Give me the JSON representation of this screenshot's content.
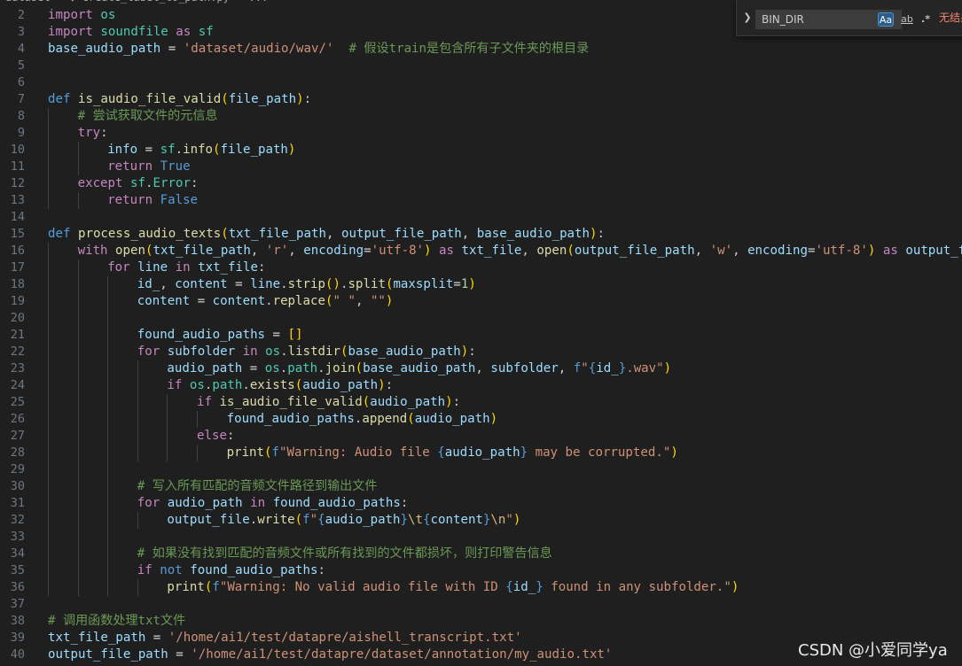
{
  "breadcrumb": "dataset > ◆ create_label_to_path.py > ...",
  "find": {
    "query": "BIN_DIR",
    "match_case": "Aa",
    "whole_word": "ab",
    "regex": ".*",
    "no_results": "无结果"
  },
  "watermark": "CSDN @小爱同学ya",
  "code_lines": [
    {
      "n": "2",
      "indent": 0,
      "tokens": [
        [
          "import",
          "ctl"
        ],
        [
          " "
        ],
        [
          "os",
          "mod"
        ]
      ]
    },
    {
      "n": "3",
      "indent": 0,
      "tokens": [
        [
          "import",
          "ctl"
        ],
        [
          " "
        ],
        [
          "soundfile",
          "mod"
        ],
        [
          " "
        ],
        [
          "as",
          "ctl"
        ],
        [
          " "
        ],
        [
          "sf",
          "mod"
        ]
      ]
    },
    {
      "n": "4",
      "indent": 0,
      "tokens": [
        [
          "base_audio_path",
          "var"
        ],
        [
          " = ",
          "op"
        ],
        [
          "'dataset/audio/wav/'",
          "str"
        ],
        [
          "  "
        ],
        [
          "# 假设train是包含所有子文件夹的根目录",
          "cmt"
        ]
      ]
    },
    {
      "n": "5",
      "indent": 0,
      "tokens": []
    },
    {
      "n": "6",
      "indent": 0,
      "tokens": []
    },
    {
      "n": "7",
      "indent": 0,
      "tokens": [
        [
          "def",
          "kw"
        ],
        [
          " "
        ],
        [
          "is_audio_file_valid",
          "fn"
        ],
        [
          "(",
          "p1"
        ],
        [
          "file_path",
          "var"
        ],
        [
          ")",
          "p1"
        ],
        [
          ":"
        ]
      ]
    },
    {
      "n": "8",
      "indent": 1,
      "tokens": [
        [
          "# 尝试获取文件的元信息",
          "cmt"
        ]
      ]
    },
    {
      "n": "9",
      "indent": 1,
      "tokens": [
        [
          "try",
          "ctl"
        ],
        [
          ":"
        ]
      ]
    },
    {
      "n": "10",
      "indent": 2,
      "tokens": [
        [
          "info",
          "var"
        ],
        [
          " = ",
          "op"
        ],
        [
          "sf",
          "mod"
        ],
        [
          "."
        ],
        [
          "info",
          "fn"
        ],
        [
          "(",
          "p1"
        ],
        [
          "file_path",
          "var"
        ],
        [
          ")",
          "p1"
        ]
      ]
    },
    {
      "n": "11",
      "indent": 2,
      "tokens": [
        [
          "return",
          "ctl"
        ],
        [
          " "
        ],
        [
          "True",
          "kw"
        ]
      ]
    },
    {
      "n": "12",
      "indent": 1,
      "tokens": [
        [
          "except",
          "ctl"
        ],
        [
          " "
        ],
        [
          "sf",
          "mod"
        ],
        [
          "."
        ],
        [
          "Error",
          "mod"
        ],
        [
          ":"
        ]
      ]
    },
    {
      "n": "13",
      "indent": 2,
      "tokens": [
        [
          "return",
          "ctl"
        ],
        [
          " "
        ],
        [
          "False",
          "kw"
        ]
      ]
    },
    {
      "n": "14",
      "indent": 0,
      "tokens": []
    },
    {
      "n": "15",
      "indent": 0,
      "tokens": [
        [
          "def",
          "kw"
        ],
        [
          " "
        ],
        [
          "process_audio_texts",
          "fn"
        ],
        [
          "(",
          "p1"
        ],
        [
          "txt_file_path",
          "var"
        ],
        [
          ", "
        ],
        [
          "output_file_path",
          "var"
        ],
        [
          ", "
        ],
        [
          "base_audio_path",
          "var"
        ],
        [
          ")",
          "p1"
        ],
        [
          ":"
        ]
      ]
    },
    {
      "n": "16",
      "indent": 1,
      "tokens": [
        [
          "with",
          "ctl"
        ],
        [
          " "
        ],
        [
          "open",
          "fn"
        ],
        [
          "(",
          "p1"
        ],
        [
          "txt_file_path",
          "var"
        ],
        [
          ", "
        ],
        [
          "'r'",
          "str"
        ],
        [
          ", "
        ],
        [
          "encoding",
          "var"
        ],
        [
          "=",
          "op"
        ],
        [
          "'utf-8'",
          "str"
        ],
        [
          ")",
          "p1"
        ],
        [
          " "
        ],
        [
          "as",
          "ctl"
        ],
        [
          " "
        ],
        [
          "txt_file",
          "var"
        ],
        [
          ", "
        ],
        [
          "open",
          "fn"
        ],
        [
          "(",
          "p1"
        ],
        [
          "output_file_path",
          "var"
        ],
        [
          ", "
        ],
        [
          "'w'",
          "str"
        ],
        [
          ", "
        ],
        [
          "encoding",
          "var"
        ],
        [
          "=",
          "op"
        ],
        [
          "'utf-8'",
          "str"
        ],
        [
          ")",
          "p1"
        ],
        [
          " "
        ],
        [
          "as",
          "ctl"
        ],
        [
          " "
        ],
        [
          "output_fi",
          "var"
        ]
      ]
    },
    {
      "n": "17",
      "indent": 2,
      "tokens": [
        [
          "for",
          "ctl"
        ],
        [
          " "
        ],
        [
          "line",
          "var"
        ],
        [
          " "
        ],
        [
          "in",
          "ctl"
        ],
        [
          " "
        ],
        [
          "txt_file",
          "var"
        ],
        [
          ":"
        ]
      ]
    },
    {
      "n": "18",
      "indent": 3,
      "tokens": [
        [
          "id_",
          "var"
        ],
        [
          ", "
        ],
        [
          "content",
          "var"
        ],
        [
          " = ",
          "op"
        ],
        [
          "line",
          "var"
        ],
        [
          "."
        ],
        [
          "strip",
          "fn"
        ],
        [
          "()",
          "p1"
        ],
        [
          "."
        ],
        [
          "split",
          "fn"
        ],
        [
          "(",
          "p1"
        ],
        [
          "maxsplit",
          "var"
        ],
        [
          "=",
          "op"
        ],
        [
          "1",
          "num"
        ],
        [
          ")",
          "p1"
        ]
      ]
    },
    {
      "n": "19",
      "indent": 3,
      "tokens": [
        [
          "content",
          "var"
        ],
        [
          " = ",
          "op"
        ],
        [
          "content",
          "var"
        ],
        [
          "."
        ],
        [
          "replace",
          "fn"
        ],
        [
          "(",
          "p1"
        ],
        [
          "\" \"",
          "str"
        ],
        [
          ", "
        ],
        [
          "\"\"",
          "str"
        ],
        [
          ")",
          "p1"
        ]
      ]
    },
    {
      "n": "20",
      "indent": 3,
      "tokens": []
    },
    {
      "n": "21",
      "indent": 3,
      "tokens": [
        [
          "found_audio_paths",
          "var"
        ],
        [
          " = ",
          "op"
        ],
        [
          "[]",
          "p1"
        ]
      ]
    },
    {
      "n": "22",
      "indent": 3,
      "tokens": [
        [
          "for",
          "ctl"
        ],
        [
          " "
        ],
        [
          "subfolder",
          "var"
        ],
        [
          " "
        ],
        [
          "in",
          "ctl"
        ],
        [
          " "
        ],
        [
          "os",
          "mod"
        ],
        [
          "."
        ],
        [
          "listdir",
          "fn"
        ],
        [
          "(",
          "p1"
        ],
        [
          "base_audio_path",
          "var"
        ],
        [
          ")",
          "p1"
        ],
        [
          ":"
        ]
      ]
    },
    {
      "n": "23",
      "indent": 4,
      "tokens": [
        [
          "audio_path",
          "var"
        ],
        [
          " = ",
          "op"
        ],
        [
          "os",
          "mod"
        ],
        [
          "."
        ],
        [
          "path",
          "mod"
        ],
        [
          "."
        ],
        [
          "join",
          "fn"
        ],
        [
          "(",
          "p1"
        ],
        [
          "base_audio_path",
          "var"
        ],
        [
          ", "
        ],
        [
          "subfolder",
          "var"
        ],
        [
          ", "
        ],
        [
          "f",
          "kw"
        ],
        [
          "\"",
          "str"
        ],
        [
          "{",
          "kw"
        ],
        [
          "id_",
          "var"
        ],
        [
          "}",
          "kw"
        ],
        [
          ".wav\"",
          "str"
        ],
        [
          ")",
          "p1"
        ]
      ]
    },
    {
      "n": "24",
      "indent": 4,
      "tokens": [
        [
          "if",
          "ctl"
        ],
        [
          " "
        ],
        [
          "os",
          "mod"
        ],
        [
          "."
        ],
        [
          "path",
          "mod"
        ],
        [
          "."
        ],
        [
          "exists",
          "fn"
        ],
        [
          "(",
          "p1"
        ],
        [
          "audio_path",
          "var"
        ],
        [
          ")",
          "p1"
        ],
        [
          ":"
        ]
      ]
    },
    {
      "n": "25",
      "indent": 5,
      "tokens": [
        [
          "if",
          "ctl"
        ],
        [
          " "
        ],
        [
          "is_audio_file_valid",
          "fn"
        ],
        [
          "(",
          "p1"
        ],
        [
          "audio_path",
          "var"
        ],
        [
          ")",
          "p1"
        ],
        [
          ":"
        ]
      ]
    },
    {
      "n": "26",
      "indent": 6,
      "tokens": [
        [
          "found_audio_paths",
          "var"
        ],
        [
          "."
        ],
        [
          "append",
          "fn"
        ],
        [
          "(",
          "p1"
        ],
        [
          "audio_path",
          "var"
        ],
        [
          ")",
          "p1"
        ]
      ]
    },
    {
      "n": "27",
      "indent": 5,
      "tokens": [
        [
          "else",
          "ctl"
        ],
        [
          ":"
        ]
      ]
    },
    {
      "n": "28",
      "indent": 6,
      "tokens": [
        [
          "print",
          "fn"
        ],
        [
          "(",
          "p1"
        ],
        [
          "f",
          "kw"
        ],
        [
          "\"Warning: Audio file ",
          "str"
        ],
        [
          "{",
          "kw"
        ],
        [
          "audio_path",
          "var"
        ],
        [
          "}",
          "kw"
        ],
        [
          " may be corrupted.\"",
          "str"
        ],
        [
          ")",
          "p1"
        ]
      ]
    },
    {
      "n": "29",
      "indent": 3,
      "tokens": []
    },
    {
      "n": "30",
      "indent": 3,
      "tokens": [
        [
          "# 写入所有匹配的音频文件路径到输出文件",
          "cmt"
        ]
      ]
    },
    {
      "n": "31",
      "indent": 3,
      "tokens": [
        [
          "for",
          "ctl"
        ],
        [
          " "
        ],
        [
          "audio_path",
          "var"
        ],
        [
          " "
        ],
        [
          "in",
          "ctl"
        ],
        [
          " "
        ],
        [
          "found_audio_paths",
          "var"
        ],
        [
          ":"
        ]
      ]
    },
    {
      "n": "32",
      "indent": 4,
      "tokens": [
        [
          "output_file",
          "var"
        ],
        [
          "."
        ],
        [
          "write",
          "fn"
        ],
        [
          "(",
          "p1"
        ],
        [
          "f",
          "kw"
        ],
        [
          "\"",
          "str"
        ],
        [
          "{",
          "kw"
        ],
        [
          "audio_path",
          "var"
        ],
        [
          "}",
          "kw"
        ],
        [
          "\\t",
          "esc"
        ],
        [
          "{",
          "kw"
        ],
        [
          "content",
          "var"
        ],
        [
          "}",
          "kw"
        ],
        [
          "\\n",
          "esc"
        ],
        [
          "\"",
          "str"
        ],
        [
          ")",
          "p1"
        ]
      ]
    },
    {
      "n": "33",
      "indent": 3,
      "tokens": []
    },
    {
      "n": "34",
      "indent": 3,
      "tokens": [
        [
          "# 如果没有找到匹配的音频文件或所有找到的文件都损坏，则打印警告信息",
          "cmt"
        ]
      ]
    },
    {
      "n": "35",
      "indent": 3,
      "tokens": [
        [
          "if",
          "ctl"
        ],
        [
          " "
        ],
        [
          "not",
          "kw"
        ],
        [
          " "
        ],
        [
          "found_audio_paths",
          "var"
        ],
        [
          ":"
        ]
      ]
    },
    {
      "n": "36",
      "indent": 4,
      "tokens": [
        [
          "print",
          "fn"
        ],
        [
          "(",
          "p1"
        ],
        [
          "f",
          "kw"
        ],
        [
          "\"Warning: No valid audio file with ID ",
          "str"
        ],
        [
          "{",
          "kw"
        ],
        [
          "id_",
          "var"
        ],
        [
          "}",
          "kw"
        ],
        [
          " found in any subfolder.\"",
          "str"
        ],
        [
          ")",
          "p1"
        ]
      ]
    },
    {
      "n": "37",
      "indent": 0,
      "tokens": []
    },
    {
      "n": "38",
      "indent": 0,
      "tokens": [
        [
          "# 调用函数处理txt文件",
          "cmt"
        ]
      ]
    },
    {
      "n": "39",
      "indent": 0,
      "tokens": [
        [
          "txt_file_path",
          "var"
        ],
        [
          " = ",
          "op"
        ],
        [
          "'/home/ai1/test/datapre/aishell_transcript.txt'",
          "str"
        ]
      ]
    },
    {
      "n": "40",
      "indent": 0,
      "tokens": [
        [
          "output_file_path",
          "var"
        ],
        [
          " = ",
          "op"
        ],
        [
          "'/home/ai1/test/datapre/dataset/annotation/my_audio.txt'",
          "str"
        ]
      ]
    }
  ]
}
